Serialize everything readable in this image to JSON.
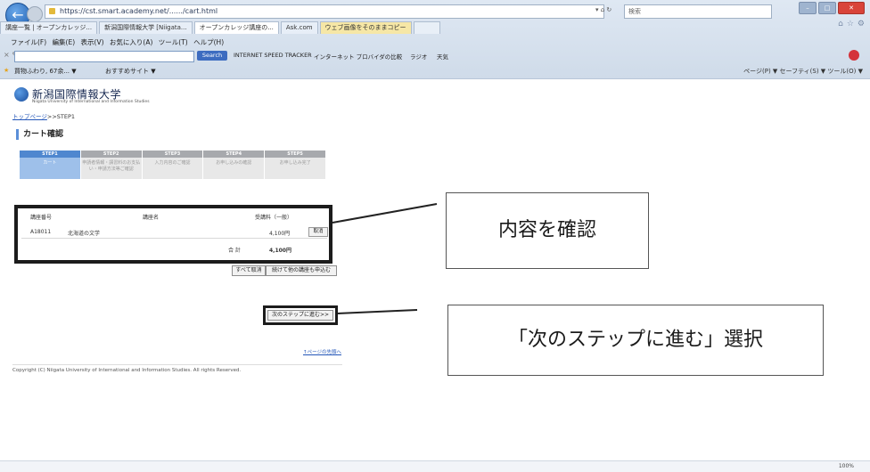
{
  "browser": {
    "address": "https://cst.smart.academy.net/....../cart.html",
    "search_placeholder": "検索",
    "tabs": [
      "講座一覧 | オープンカレッジ...",
      "新潟国際情報大学 [Niigata...",
      "オープンカレッジ講座の...",
      "Ask.com",
      "ウェブ画像をそのままコピー",
      ""
    ],
    "menu": [
      "ファイル(F)",
      "編集(E)",
      "表示(V)",
      "お気に入り(A)",
      "ツール(T)",
      "ヘルプ(H)"
    ],
    "toolbar": {
      "search_button": "Search",
      "speed_tracker": "INTERNET SPEED TRACKER",
      "compare": "インターネット プロバイダの比較",
      "radio": "ラジオ",
      "weather": "天気"
    },
    "favorites": {
      "item1": "買物ふわり, 67余... ▼",
      "item2": "おすすめサイト ▼"
    },
    "commands": "ページ(P) ▼  セーフティ(S) ▼  ツール(O) ▼",
    "zoom": "100%"
  },
  "page": {
    "logo_text": "新潟国際情報大学",
    "logo_sub": "Niigata University of International and Information Studies",
    "breadcrumb_link": "トップページ",
    "breadcrumb_rest": ">>STEP1",
    "heading": "カート確認",
    "steps": [
      {
        "num": "STEP1",
        "label": "カート"
      },
      {
        "num": "STEP2",
        "label": "申請者情報・講習料のお支払い・申請方法等ご確認"
      },
      {
        "num": "STEP3",
        "label": "入力内容のご確認"
      },
      {
        "num": "STEP4",
        "label": "お申し込みの確認"
      },
      {
        "num": "STEP5",
        "label": "お申し込み完了"
      }
    ],
    "cart": {
      "col_code": "講座番号",
      "col_name": "講座名",
      "col_fee": "受講料（一般）",
      "row_code": "A18011",
      "row_name": "北海道の文学",
      "row_fee": "4,100円",
      "cancel": "取消",
      "total_label": "合 計",
      "total_value": "4,100円"
    },
    "btn_cancel_all": "すべて取消",
    "btn_continue": "続けて他の講座も申込む",
    "btn_next": "次のステップに進む>>",
    "page_top": "↑ページの先頭へ",
    "copyright": "Copyright (C) Niigata University of International and Information Studies. All rights Reserved."
  },
  "callouts": {
    "confirm": "内容を確認",
    "select_next": "「次のステップに進む」選択"
  }
}
